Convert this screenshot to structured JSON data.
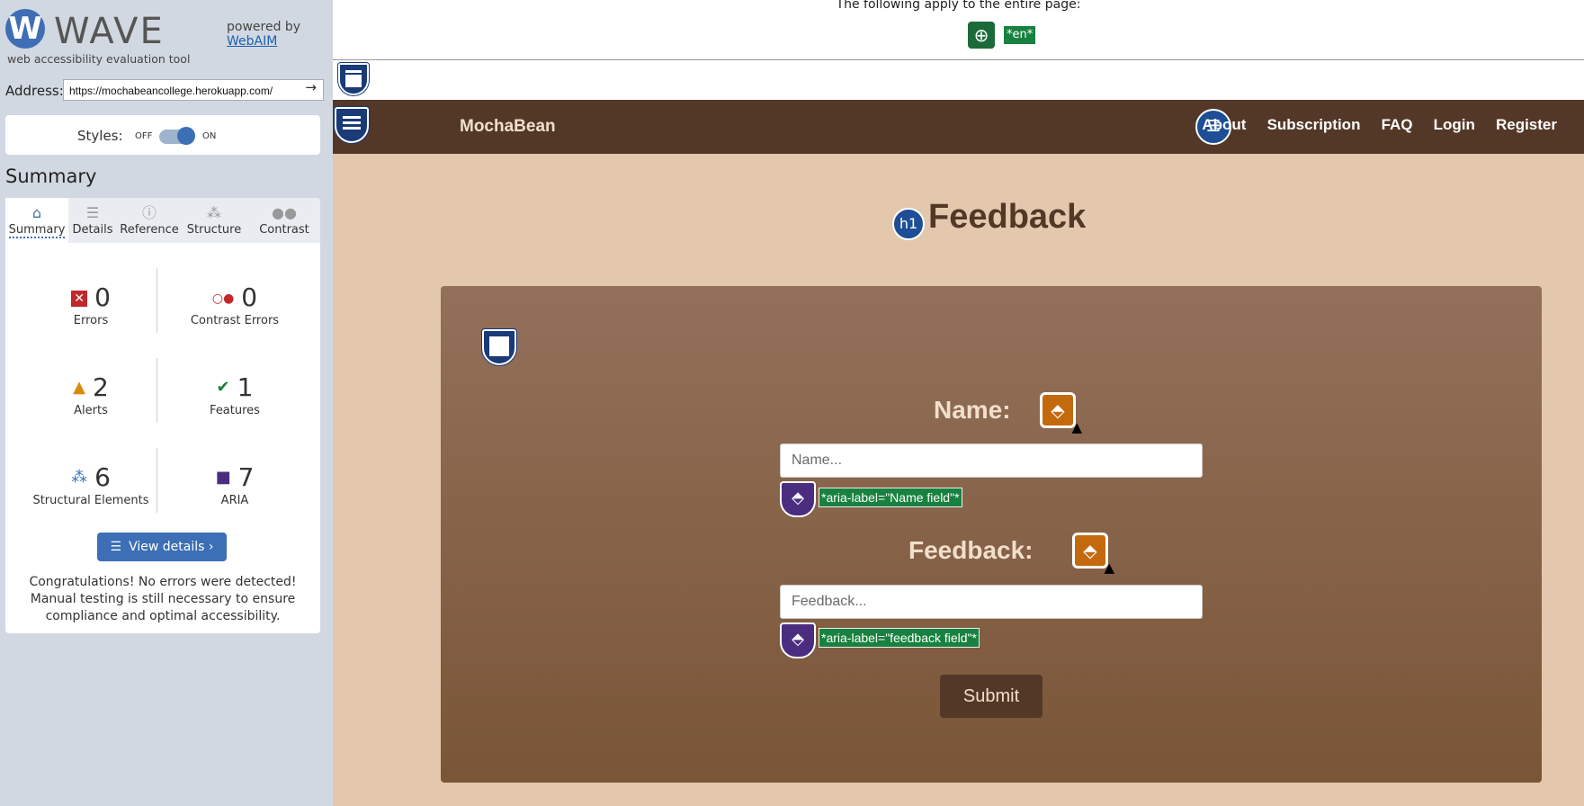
{
  "sidebar": {
    "logo_text": "WAVE",
    "logo_sub": "web accessibility evaluation tool",
    "powered_by": "powered by",
    "webaim_link": "WebAIM",
    "address_label": "Address:",
    "address_value": "https://mochabeancollege.herokuapp.com/",
    "styles_label": "Styles:",
    "toggle_off": "OFF",
    "toggle_on": "ON",
    "summary_title": "Summary",
    "tabs": [
      {
        "label": "Summary",
        "icon": "home-icon",
        "active": true
      },
      {
        "label": "Details",
        "icon": "list-icon"
      },
      {
        "label": "Reference",
        "icon": "info-icon"
      },
      {
        "label": "Structure",
        "icon": "structure-icon"
      },
      {
        "label": "Contrast",
        "icon": "contrast-icon"
      }
    ],
    "stats": {
      "errors": {
        "count": "0",
        "label": "Errors"
      },
      "contrast_errors": {
        "count": "0",
        "label": "Contrast Errors"
      },
      "alerts": {
        "count": "2",
        "label": "Alerts"
      },
      "features": {
        "count": "1",
        "label": "Features"
      },
      "structural": {
        "count": "6",
        "label": "Structural Elements"
      },
      "aria": {
        "count": "7",
        "label": "ARIA"
      }
    },
    "view_details": "View details ›",
    "congrats": "Congratulations! No errors were detected! Manual testing is still necessary to ensure compliance and optimal accessibility."
  },
  "page": {
    "top_notice": "The following apply to the entire page:",
    "lang_badge": "*en*",
    "brand": "MochaBean",
    "nav": [
      "About",
      "Subscription",
      "FAQ",
      "Login",
      "Register"
    ],
    "h1_badge": "h1",
    "heading": "Feedback",
    "name_label": "Name:",
    "name_placeholder": "Name...",
    "name_aria": "*aria-label=\"Name field\"*",
    "feedback_label": "Feedback:",
    "feedback_placeholder": "Feedback...",
    "feedback_aria": "*aria-label=\"feedback field\"*",
    "submit": "Submit"
  },
  "colors": {
    "wave_blue": "#3c6fb5",
    "nav_brown": "#533828",
    "page_bg": "#e4c8ae",
    "aria_purple": "#4b2d80",
    "alert_orange": "#c46a0e",
    "feature_green": "#18813f"
  }
}
